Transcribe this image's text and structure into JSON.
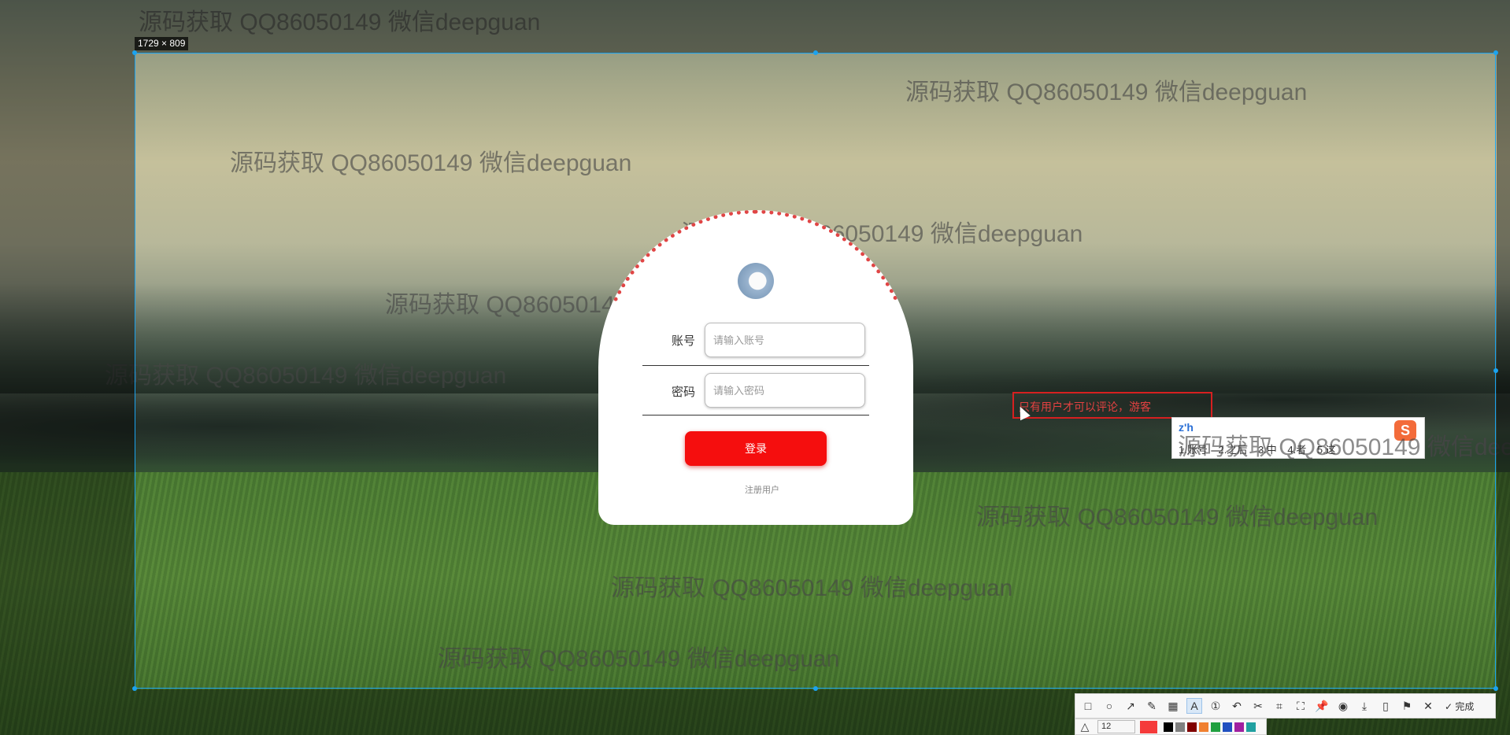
{
  "capture": {
    "size_label": "1729 × 809"
  },
  "watermarks": [
    "源码获取 QQ86050149 微信deepguan",
    "源码获取 QQ86050149 微信deepguan",
    "源码获取 QQ86050149 微信deepguan",
    "源码获取 QQ86050149 微信deepguan",
    "源码获取 QQ86050149 微信deepguan",
    "源码获取 QQ86050149 微信deepguan",
    "源码获取 QQ86050149 微信deepguan",
    "源码获取 QQ86050149 微信deepguan",
    "源码获取 QQ86050149 微信deepguan",
    "源码获取 QQ86050149 微信deepguan",
    "源码获取 QQ86050149 微信deepguan"
  ],
  "login": {
    "account_label": "账号",
    "account_placeholder": "请输入账号",
    "password_label": "密码",
    "password_placeholder": "请输入密码",
    "login_button": "登录",
    "register_link": "注册用户"
  },
  "annotation": {
    "text": "只有用户才可以评论，游客"
  },
  "ime": {
    "input": "z'h",
    "candidates": [
      "1.账号",
      "2.之后",
      "3.中",
      "4.者",
      "5.这"
    ],
    "logo": "S"
  },
  "toolbar": {
    "tools": [
      "rectangle-icon",
      "ellipse-icon",
      "arrow-icon",
      "pen-icon",
      "mosaic-icon",
      "text-icon",
      "number-icon",
      "undo-icon",
      "scissors-icon",
      "ocr-icon",
      "screenshot-icon",
      "pin-icon",
      "record-icon",
      "download-icon",
      "phone-icon",
      "bookmark-icon",
      "close-icon"
    ],
    "done_label": "完成",
    "font_size": "12",
    "colors": [
      "#000000",
      "#808080",
      "#800000",
      "#f08030",
      "#20a040",
      "#2050c0",
      "#a020a0",
      "#20a0a0"
    ],
    "active_color": "#f53b3b"
  }
}
